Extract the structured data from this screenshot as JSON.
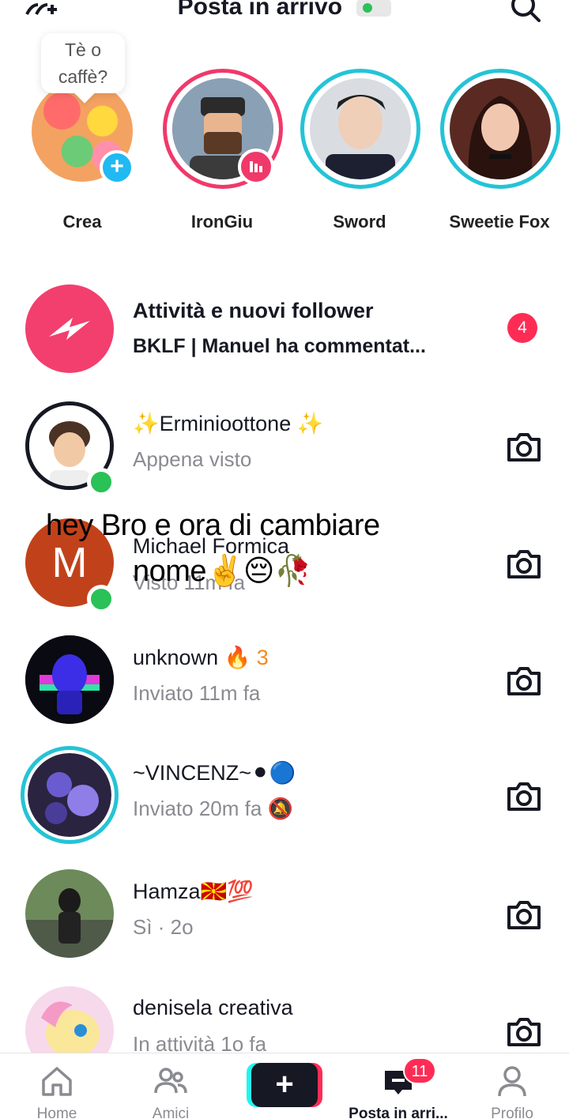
{
  "header": {
    "title": "Posta in arrivo",
    "add_friend_label": "⁺⁺"
  },
  "stories": [
    {
      "name": "Crea",
      "bubble": "Tè o caffè?"
    },
    {
      "name": "IronGiu"
    },
    {
      "name": "Sword"
    },
    {
      "name": "Sweetie Fox"
    }
  ],
  "activity": {
    "title": "Attività e nuovi follower",
    "subtitle": "BKLF | Manuel ha commentat...",
    "count": "4"
  },
  "conversations": [
    {
      "name": "✨Erminioottone ✨",
      "status": "Appena visto"
    },
    {
      "name": "Michael Formica",
      "status": "Visto 11m fa",
      "initial": "M"
    },
    {
      "name": "unknown 🔥",
      "streak": "3",
      "status": "Inviato 11m fa"
    },
    {
      "name": "~VINCENZ~⚫🔵",
      "status": "Inviato 20m fa 🔕"
    },
    {
      "name": "Hamza🇲🇰💯",
      "status": "Sì · 2o"
    },
    {
      "name": "denisela creativa",
      "status": "In attività 1o fa"
    }
  ],
  "caption": {
    "line1": "hey Bro e ora di cambiare",
    "line2": "nome✌️😔🥀"
  },
  "tabbar": {
    "home": "Home",
    "friends": "Amici",
    "create": "+",
    "inbox": "Posta in arri...",
    "inbox_badge": "11",
    "profile": "Profilo"
  },
  "colors": {
    "accent_pink": "#fe2c55",
    "accent_teal": "#25c3d6",
    "online_green": "#2ac157",
    "create_blue": "#21b9f2"
  }
}
